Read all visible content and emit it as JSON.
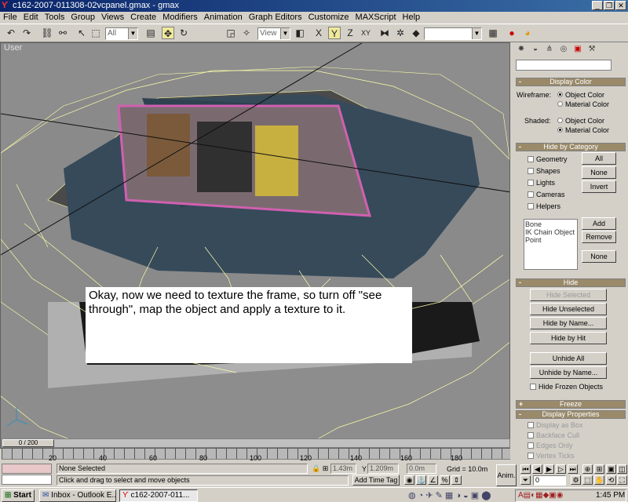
{
  "window": {
    "title": "c162-2007-011308-02vcpanel.gmax - gmax",
    "app_icon": "gmax-icon",
    "minimize": "_",
    "restore": "❐",
    "close": "✕"
  },
  "menu": [
    "File",
    "Edit",
    "Tools",
    "Group",
    "Views",
    "Create",
    "Modifiers",
    "Animation",
    "Graph Editors",
    "Customize",
    "MAXScript",
    "Help"
  ],
  "toolbar": {
    "selection_filter": "All",
    "ref_coord": "View",
    "named_selection": ""
  },
  "viewport": {
    "label": "User",
    "overlay_text": "Okay, now we need to texture the frame, so turn off \"see through\", map the object and apply a texture to it."
  },
  "command_panel": {
    "display_color": {
      "header": "Display Color",
      "wireframe_label": "Wireframe:",
      "shaded_label": "Shaded:",
      "opt_object": "Object Color",
      "opt_material": "Material Color"
    },
    "hide_by_category": {
      "header": "Hide by Category",
      "items": [
        "Geometry",
        "Shapes",
        "Lights",
        "Cameras",
        "Helpers"
      ],
      "all": "All",
      "none": "None",
      "invert": "Invert",
      "list": [
        "Bone",
        "IK Chain Object",
        "Point"
      ],
      "add": "Add",
      "remove": "Remove",
      "none2": "None"
    },
    "hide": {
      "header": "Hide",
      "hide_selected": "Hide Selected",
      "hide_unselected": "Hide Unselected",
      "hide_by_name": "Hide by Name...",
      "hide_by_hit": "Hide by Hit",
      "unhide_all": "Unhide All",
      "unhide_by_name": "Unhide by Name...",
      "hide_frozen": "Hide Frozen Objects"
    },
    "freeze": {
      "header": "Freeze"
    },
    "display_properties": {
      "header": "Display Properties",
      "items": [
        "Display as Box",
        "Backface Cull",
        "Edges Only",
        "Vertex Ticks"
      ]
    }
  },
  "timeline": {
    "frame_counter": "0 / 200",
    "ticks": [
      "20",
      "40",
      "60",
      "80",
      "100",
      "120",
      "140",
      "160",
      "180"
    ]
  },
  "status": {
    "selection": "None Selected",
    "prompt": "Click and drag to select and move objects",
    "x_value": "1.43m",
    "y_label": "Y",
    "y_value": "1.209m",
    "z_value": "0.0m",
    "grid": "Grid = 10.0m",
    "add_time_tag": "Add Time Tag",
    "anim": "Anim.",
    "frame_field": "0"
  },
  "taskbar": {
    "start": "Start",
    "items": [
      "Inbox - Outlook E...",
      "c162-2007-011..."
    ],
    "clock": "1:45 PM"
  }
}
